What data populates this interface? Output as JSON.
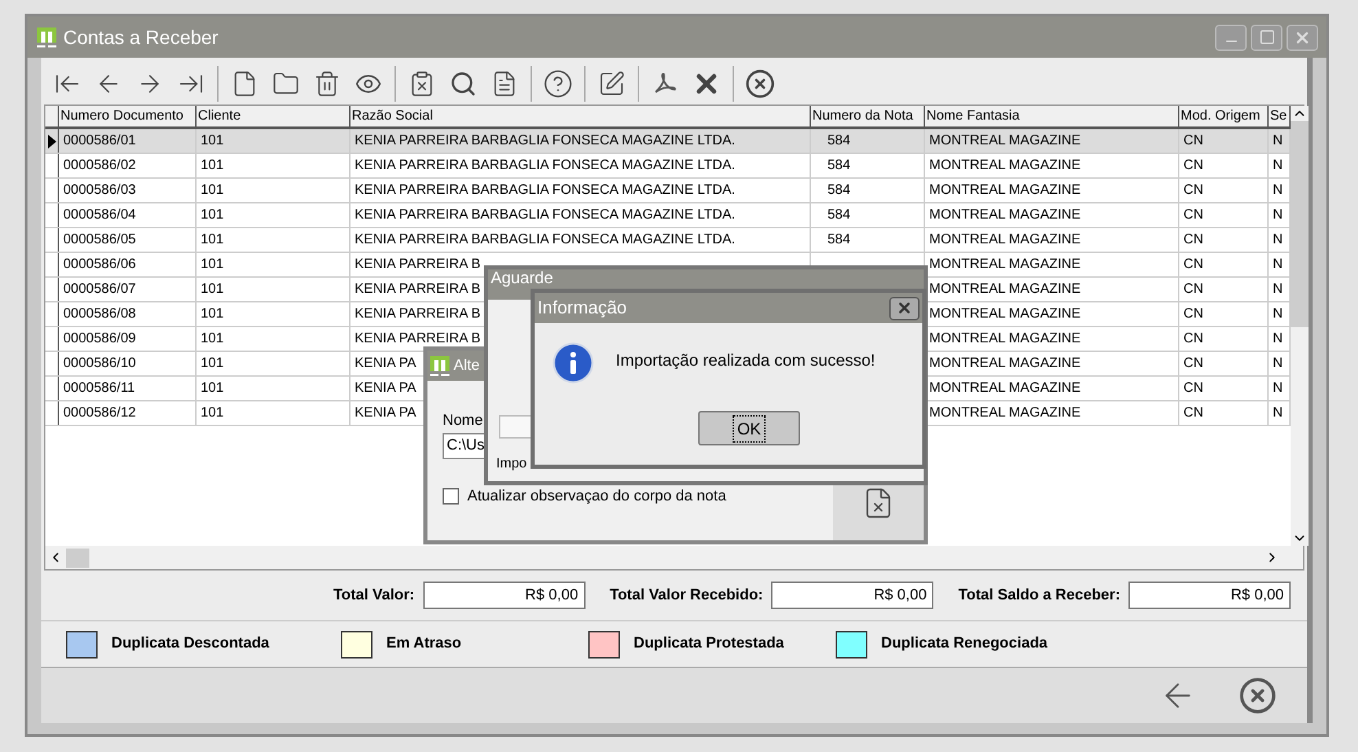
{
  "window": {
    "title": "Contas a Receber"
  },
  "grid": {
    "columns": [
      "Numero Documento",
      "Cliente",
      "Razão Social",
      "Numero da Nota",
      "Nome Fantasia",
      "Mod. Origem",
      "Se"
    ],
    "rows": [
      {
        "selected": true,
        "documento": "0000586/01",
        "cliente": "101",
        "razao": "KENIA PARREIRA BARBAGLIA FONSECA MAGAZINE LTDA.",
        "nota": "584",
        "fantasia": "MONTREAL MAGAZINE",
        "origem": "CN",
        "column_7": "N"
      },
      {
        "selected": false,
        "documento": "0000586/02",
        "cliente": "101",
        "razao": "KENIA PARREIRA BARBAGLIA FONSECA MAGAZINE LTDA.",
        "nota": "584",
        "fantasia": "MONTREAL MAGAZINE",
        "origem": "CN",
        "column_7": "N"
      },
      {
        "selected": false,
        "documento": "0000586/03",
        "cliente": "101",
        "razao": "KENIA PARREIRA BARBAGLIA FONSECA MAGAZINE LTDA.",
        "nota": "584",
        "fantasia": "MONTREAL MAGAZINE",
        "origem": "CN",
        "column_7": "N"
      },
      {
        "selected": false,
        "documento": "0000586/04",
        "cliente": "101",
        "razao": "KENIA PARREIRA BARBAGLIA FONSECA MAGAZINE LTDA.",
        "nota": "584",
        "fantasia": "MONTREAL MAGAZINE",
        "origem": "CN",
        "column_7": "N"
      },
      {
        "selected": false,
        "documento": "0000586/05",
        "cliente": "101",
        "razao": "KENIA PARREIRA BARBAGLIA FONSECA MAGAZINE LTDA.",
        "nota": "584",
        "fantasia": "MONTREAL MAGAZINE",
        "origem": "CN",
        "column_7": "N"
      },
      {
        "selected": false,
        "documento": "0000586/06",
        "cliente": "101",
        "razao": "KENIA PARREIRA B",
        "fantasia": "MONTREAL MAGAZINE",
        "origem": "CN",
        "column_7": "N"
      },
      {
        "selected": false,
        "documento": "0000586/07",
        "cliente": "101",
        "razao": "KENIA PARREIRA B",
        "fantasia": "MONTREAL MAGAZINE",
        "origem": "CN",
        "column_7": "N"
      },
      {
        "selected": false,
        "documento": "0000586/08",
        "cliente": "101",
        "razao": "KENIA PARREIRA B",
        "fantasia": "MONTREAL MAGAZINE",
        "origem": "CN",
        "column_7": "N"
      },
      {
        "selected": false,
        "documento": "0000586/09",
        "cliente": "101",
        "razao": "KENIA PARREIRA B",
        "fantasia": "MONTREAL MAGAZINE",
        "origem": "CN",
        "column_7": "N"
      },
      {
        "selected": false,
        "documento": "0000586/10",
        "cliente": "101",
        "razao": "KENIA PA",
        "fantasia": "MONTREAL MAGAZINE",
        "origem": "CN",
        "column_7": "N"
      },
      {
        "selected": false,
        "documento": "0000586/11",
        "cliente": "101",
        "razao": "KENIA PA",
        "fantasia": "MONTREAL MAGAZINE",
        "origem": "CN",
        "column_7": "N"
      },
      {
        "selected": false,
        "documento": "0000586/12",
        "cliente": "101",
        "razao": "KENIA PA",
        "fantasia": "MONTREAL MAGAZINE",
        "origem": "CN",
        "column_7": "N"
      }
    ]
  },
  "totals": [
    {
      "label": "Total Valor:",
      "value": "R$ 0,00"
    },
    {
      "label": "Total Valor Recebido:",
      "value": "R$ 0,00"
    },
    {
      "label": "Total Saldo a Receber:",
      "value": "R$ 0,00"
    }
  ],
  "legend": [
    {
      "label": "Duplicata Descontada",
      "color": "#a8c8f0"
    },
    {
      "label": "Em Atraso",
      "color": "#ffffe0"
    },
    {
      "label": "Duplicata Protestada",
      "color": "#ffc4c4"
    },
    {
      "label": "Duplicata Renegociada",
      "color": "#80ffff"
    }
  ],
  "import_dialog": {
    "title": "Alte",
    "file_label": "Nome",
    "file_value": "C:\\Us",
    "update_notes": {
      "label": "Atualizar observaçao do corpo da nota",
      "checked": false
    }
  },
  "wait_dialog": {
    "title": "Aguarde",
    "progress": {
      "level": 0
    },
    "status": "Impo"
  },
  "info_dialog": {
    "title": "Informação",
    "message": "Importação realizada com sucesso!",
    "button": "OK"
  }
}
